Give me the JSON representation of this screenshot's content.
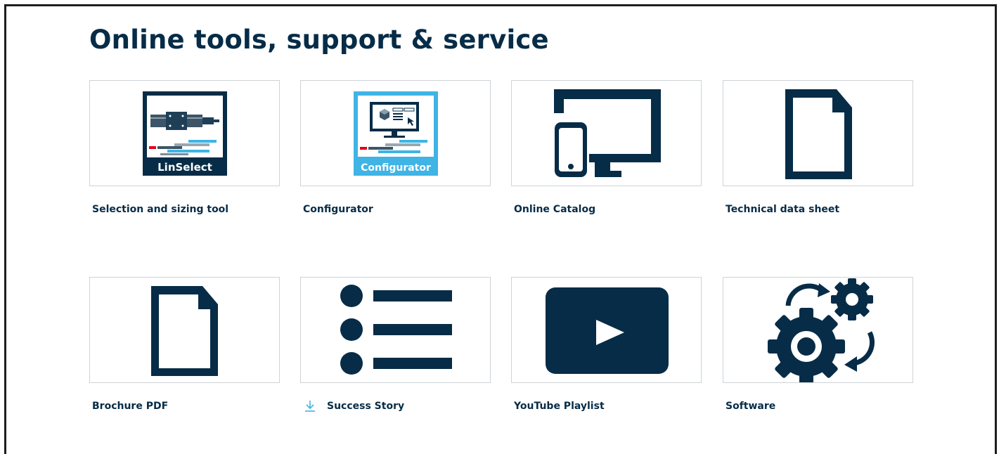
{
  "page": {
    "title": "Online tools, support & service"
  },
  "colors": {
    "navy": "#072c47",
    "light_blue": "#3fb4e5",
    "tile_border": "#cfd3d6"
  },
  "tiles": [
    {
      "label": "Selection and sizing tool",
      "icon": "linselect-icon",
      "icon_text": "LinSelect"
    },
    {
      "label": "Configurator",
      "icon": "configurator-icon",
      "icon_text": "Configurator"
    },
    {
      "label": "Online Catalog",
      "icon": "devices-icon"
    },
    {
      "label": "Technical data sheet",
      "icon": "document-icon"
    },
    {
      "label": "Brochure PDF",
      "icon": "document-icon"
    },
    {
      "label": "Success Story",
      "icon": "list-icon",
      "prefix_icon": "download-icon"
    },
    {
      "label": "YouTube Playlist",
      "icon": "play-video-icon"
    },
    {
      "label": "Software",
      "icon": "gears-icon"
    }
  ]
}
